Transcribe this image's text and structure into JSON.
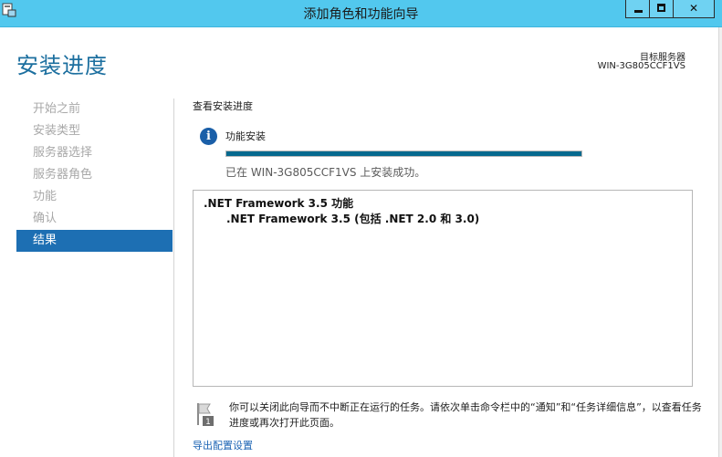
{
  "window": {
    "title": "添加角色和功能向导",
    "controls": {
      "minimize": "minimize",
      "maximize": "maximize",
      "close": "x"
    }
  },
  "header": {
    "title": "安装进度",
    "target_server_label": "目标服务器",
    "target_server_name": "WIN-3G805CCF1VS"
  },
  "sidebar": {
    "items": [
      {
        "label": "开始之前",
        "active": false
      },
      {
        "label": "安装类型",
        "active": false
      },
      {
        "label": "服务器选择",
        "active": false
      },
      {
        "label": "服务器角色",
        "active": false
      },
      {
        "label": "功能",
        "active": false
      },
      {
        "label": "确认",
        "active": false
      },
      {
        "label": "结果",
        "active": true
      }
    ]
  },
  "main": {
    "section_title": "查看安装进度",
    "feature_install_label": "功能安装",
    "progress_fraction": 1.0,
    "status_message": "已在 WIN-3G805CCF1VS 上安装成功。",
    "results": {
      "main": ".NET Framework 3.5 功能",
      "sub": ".NET Framework 3.5 (包括 .NET 2.0 和 3.0)"
    },
    "note": "你可以关闭此向导而不中断正在运行的任务。请依次单击命令栏中的“通知”和“任务详细信息”，以查看任务进度或再次打开此页面。",
    "export_link": "导出配置设置"
  },
  "colors": {
    "titlebar": "#52c8ee",
    "heading": "#1c6f9f",
    "active_nav": "#1d6fb3",
    "progress": "#05698e",
    "link": "#1c64b4"
  },
  "icons": [
    "app-icon",
    "info-icon",
    "notification-flag-icon"
  ]
}
